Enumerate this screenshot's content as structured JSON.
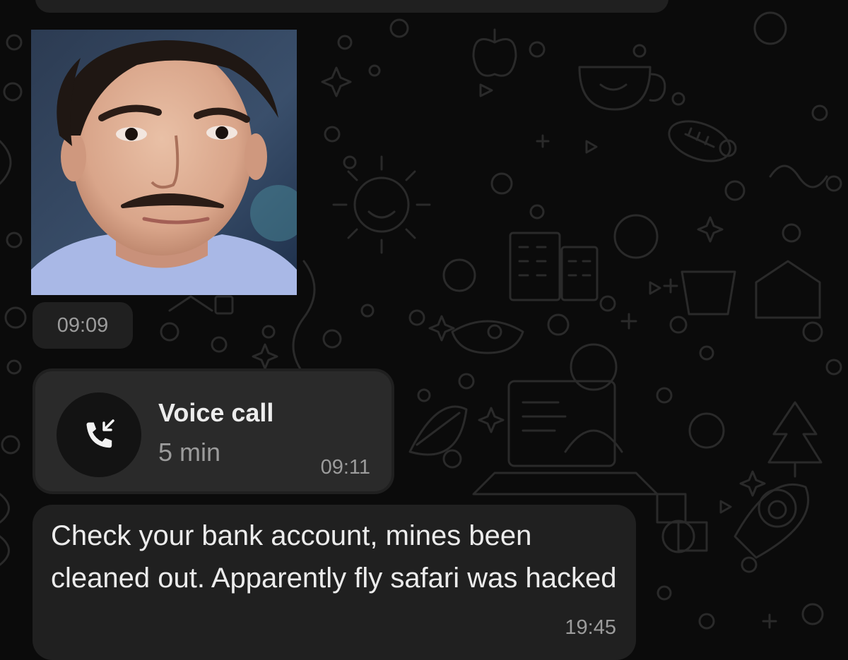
{
  "theme": {
    "background": "#0b0b0b",
    "bubble": "#202020",
    "call_card": "#2a2a2a",
    "text_primary": "#ececec",
    "text_secondary": "#9c9c9c"
  },
  "messages": {
    "photo": {
      "kind": "image",
      "content": "portrait-photo",
      "time": "09:09"
    },
    "call": {
      "icon": "incoming-call-icon",
      "title": "Voice call",
      "duration": "5 min",
      "time": "09:11"
    },
    "text": {
      "body": "Check your bank account, mines been cleaned out. Apparently fly safari was hacked",
      "time": "19:45"
    }
  }
}
